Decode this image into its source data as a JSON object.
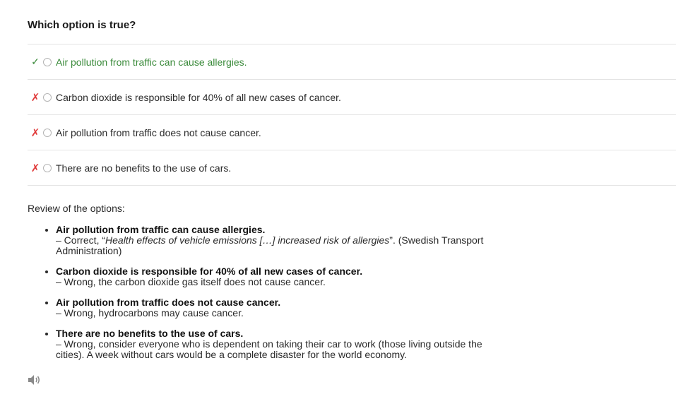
{
  "question": {
    "title": "Which option is true?"
  },
  "options": [
    {
      "text": "Air pollution from traffic can cause allergies.",
      "mark": "✓",
      "result": "correct"
    },
    {
      "text": "Carbon dioxide is responsible for 40% of all new cases of cancer.",
      "mark": "✗",
      "result": "wrong"
    },
    {
      "text": "Air pollution from traffic does not cause cancer.",
      "mark": "✗",
      "result": "wrong"
    },
    {
      "text": "There are no benefits to the use of cars.",
      "mark": "✗",
      "result": "wrong"
    }
  ],
  "review": {
    "title": "Review of the options:",
    "items": [
      {
        "heading": "Air pollution from traffic can cause allergies.",
        "before": "– Correct, “",
        "quote": "Health effects of vehicle emissions […] increased risk of allergies",
        "after": "”. (Swedish Transport Administration)"
      },
      {
        "heading": "Carbon dioxide is responsible for 40% of all new cases of cancer.",
        "before": "– Wrong, the carbon dioxide gas itself does not cause cancer.",
        "quote": "",
        "after": ""
      },
      {
        "heading": "Air pollution from traffic does not cause cancer.",
        "before": "– Wrong, hydrocarbons may cause cancer.",
        "quote": "",
        "after": ""
      },
      {
        "heading": "There are no benefits to the use of cars.",
        "before": "– Wrong, consider everyone who is dependent on taking their car to work (those living outside the cities). A week without cars would be a complete disaster for the world economy.",
        "quote": "",
        "after": ""
      }
    ]
  },
  "audio": {
    "icon": "speaker-icon"
  },
  "colors": {
    "correct": "#3a8a3a",
    "wrong": "#e03a3a",
    "divider": "#e4e4e4"
  }
}
